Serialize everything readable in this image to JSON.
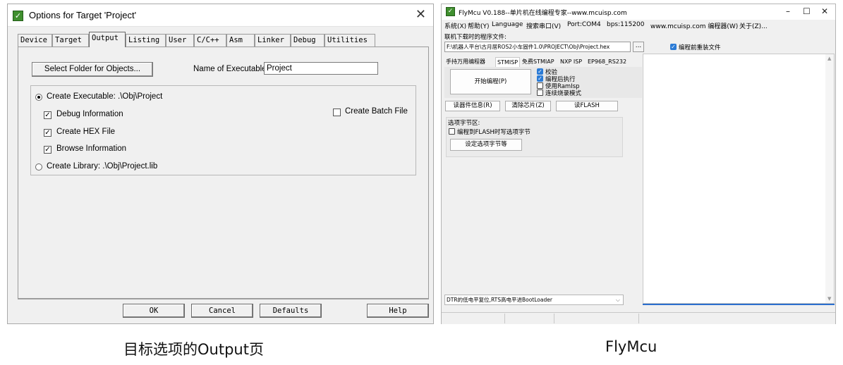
{
  "options_dialog": {
    "title": "Options for Target 'Project'",
    "tabs": [
      "Device",
      "Target",
      "Output",
      "Listing",
      "User",
      "C/C++",
      "Asm",
      "Linker",
      "Debug",
      "Utilities"
    ],
    "active_tab": "Output",
    "select_folder_label": "Select Folder for Objects...",
    "name_of_executable_label": "Name of Executable:",
    "name_of_executable_value": "Project",
    "create_executable_label": "Create Executable:  .\\Obj\\Project",
    "debug_info_label": "Debug Information",
    "create_hex_label": "Create HEX File",
    "browse_info_label": "Browse Information",
    "create_batch_label": "Create Batch File",
    "create_library_label": "Create Library:  .\\Obj\\Project.lib",
    "create_executable_selected": true,
    "debug_info_checked": true,
    "create_hex_checked": true,
    "browse_info_checked": true,
    "create_batch_checked": false,
    "buttons": {
      "ok": "OK",
      "cancel": "Cancel",
      "defaults": "Defaults",
      "help": "Help"
    }
  },
  "flymcu": {
    "title": "FlyMcu V0.188--单片机在线编程专家--www.mcuisp.com",
    "menu": {
      "system": "系统(X)",
      "help": "帮助(Y)",
      "language": "Language",
      "search_port": "搜索串口(V)",
      "port": "Port:COM4",
      "bps": "bps:115200",
      "site": "www.mcuisp.com 编程器(W)",
      "about": "关于(Z)..."
    },
    "program_file_label": "联机下载时的程序文件:",
    "program_file_path": "F:\\机器人平台\\古月居ROS2小车固件1.0\\PROJECT\\Obj\\Project.hex",
    "browse_button": "...",
    "reload_label": "编程前重装文件",
    "reload_checked": true,
    "tabs": [
      "手持万用编程器",
      "STMISP",
      "免费STMIAP",
      "NXP ISP",
      "EP968_RS232"
    ],
    "active_tab": "STMISP",
    "start_button": "开始编程(P)",
    "options": [
      {
        "label": "校验",
        "checked": true
      },
      {
        "label": "编程后执行",
        "checked": true
      },
      {
        "label": "使用RamIsp",
        "checked": false
      },
      {
        "label": "连续烧录模式",
        "checked": false
      }
    ],
    "read_info_button": "读器件信息(R)",
    "erase_button": "清除芯片(Z)",
    "read_flash_button": "读FLASH",
    "option_bytes_label": "选项字节区:",
    "write_option_label": "编程到FLASH时写选项字节",
    "set_option_button": "设定选项字节等",
    "dtr_combo": "DTR的低电平复位,RTS高电平进BootLoader"
  },
  "captions": {
    "left": "目标选项的Output页",
    "right": "FlyMcu"
  }
}
